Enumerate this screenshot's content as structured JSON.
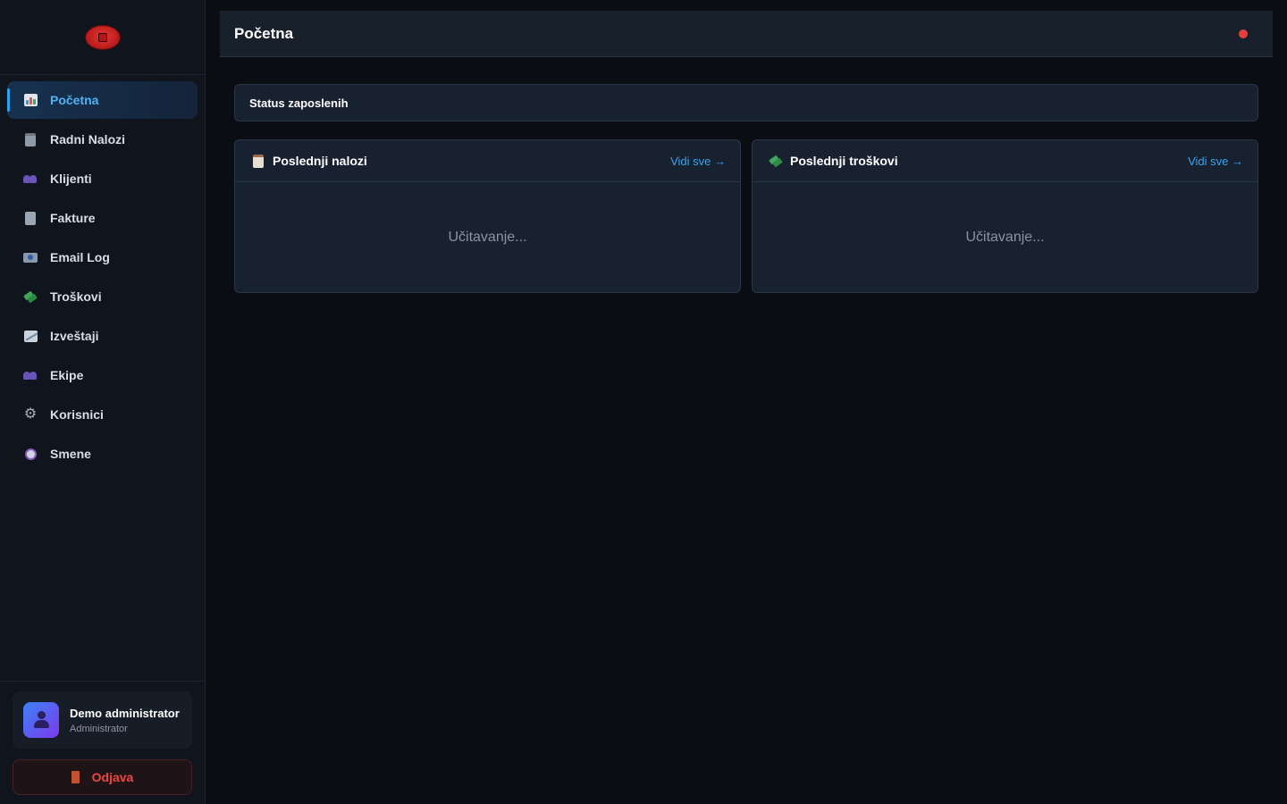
{
  "sidebar": {
    "items": [
      {
        "label": "Početna",
        "icon": "bar-chart-icon",
        "active": true
      },
      {
        "label": "Radni Nalozi",
        "icon": "clipboard-icon",
        "active": false
      },
      {
        "label": "Klijenti",
        "icon": "users-icon",
        "active": false
      },
      {
        "label": "Fakture",
        "icon": "document-icon",
        "active": false
      },
      {
        "label": "Email Log",
        "icon": "envelope-icon",
        "active": false
      },
      {
        "label": "Troškovi",
        "icon": "money-icon",
        "active": false
      },
      {
        "label": "Izveštaji",
        "icon": "trend-chart-icon",
        "active": false
      },
      {
        "label": "Ekipe",
        "icon": "users-icon",
        "active": false
      },
      {
        "label": "Korisnici",
        "icon": "gear-icon",
        "active": false
      },
      {
        "label": "Smene",
        "icon": "clock-icon",
        "active": false
      }
    ],
    "user": {
      "name": "Demo administrator",
      "role": "Administrator"
    },
    "logout_label": "Odjava"
  },
  "header": {
    "title": "Početna",
    "status_color": "#e53e3e"
  },
  "main": {
    "status_panel_title": "Status zaposlenih",
    "cards": [
      {
        "title": "Poslednji nalozi",
        "link": "Vidi sve →",
        "body": "Učitavanje..."
      },
      {
        "title": "Poslednji troškovi",
        "link": "Vidi sve →",
        "body": "Učitavanje..."
      }
    ]
  },
  "colors": {
    "accent": "#2f9ff0",
    "danger": "#ef4444",
    "background": "#0a0d12"
  }
}
